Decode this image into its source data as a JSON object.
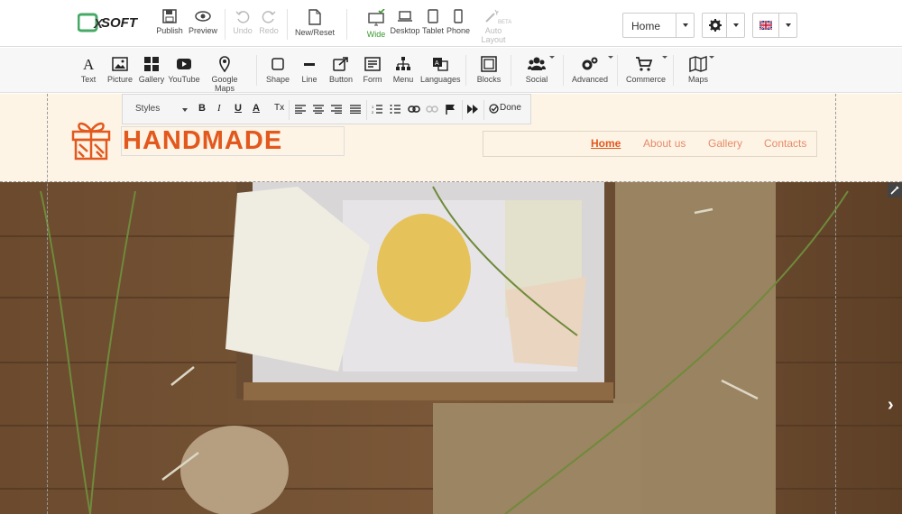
{
  "topbar": {
    "logo_text": "SOFT",
    "buttons": [
      {
        "label": "Publish",
        "icon": "save-icon"
      },
      {
        "label": "Preview",
        "icon": "eye-icon"
      },
      {
        "label": "Undo",
        "icon": "undo-icon"
      },
      {
        "label": "Redo",
        "icon": "redo-icon"
      },
      {
        "label": "New/Reset",
        "icon": "page-icon"
      },
      {
        "label": "Wide",
        "icon": "monitor-icon"
      },
      {
        "label": "Desktop",
        "icon": "laptop-icon"
      },
      {
        "label": "Tablet",
        "icon": "tablet-icon"
      },
      {
        "label": "Phone",
        "icon": "phone-icon"
      },
      {
        "label": "Auto Layout",
        "icon": "magic-wand-icon",
        "badge": "BETA"
      }
    ],
    "page_select": "Home",
    "language_flag": "uk-flag-icon",
    "accent": "#3a9a2e"
  },
  "elements": [
    {
      "label": "Text",
      "icon": "text-icon"
    },
    {
      "label": "Picture",
      "icon": "picture-icon"
    },
    {
      "label": "Gallery",
      "icon": "gallery-icon"
    },
    {
      "label": "YouTube",
      "icon": "youtube-icon"
    },
    {
      "label": "Google Maps",
      "icon": "map-pin-icon"
    },
    {
      "label": "Shape",
      "icon": "shape-icon"
    },
    {
      "label": "Line",
      "icon": "line-icon"
    },
    {
      "label": "Button",
      "icon": "button-icon"
    },
    {
      "label": "Form",
      "icon": "form-icon"
    },
    {
      "label": "Menu",
      "icon": "menu-icon"
    },
    {
      "label": "Languages",
      "icon": "languages-icon"
    },
    {
      "label": "Blocks",
      "icon": "blocks-icon"
    },
    {
      "label": "Social",
      "icon": "social-icon"
    },
    {
      "label": "Advanced",
      "icon": "gears-icon"
    },
    {
      "label": "Commerce",
      "icon": "cart-icon"
    },
    {
      "label": "Maps",
      "icon": "folded-map-icon"
    }
  ],
  "text_toolbar": {
    "styles_label": "Styles",
    "bold": "B",
    "italic": "I",
    "underline": "U",
    "color": "A",
    "clear": "Tx",
    "done_label": "Done"
  },
  "site": {
    "brand": "HANDMADE",
    "brand_color": "#e2581d",
    "header_bg": "#fdf4e6",
    "nav": [
      {
        "label": "Home",
        "active": true
      },
      {
        "label": "About us"
      },
      {
        "label": "Gallery"
      },
      {
        "label": "Contacts"
      }
    ]
  }
}
